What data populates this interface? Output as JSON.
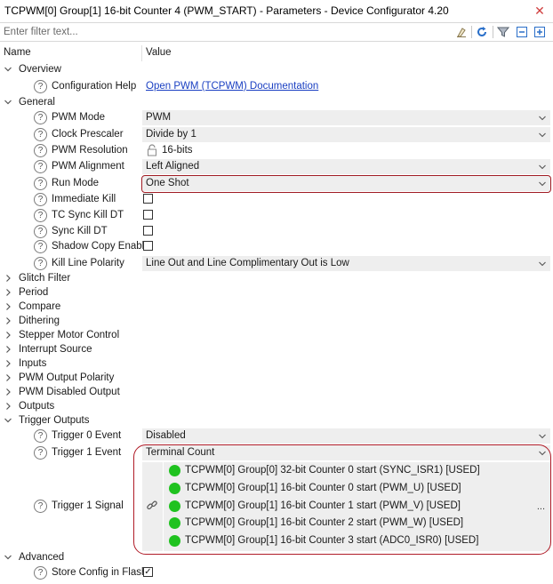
{
  "window": {
    "title": "TCPWM[0] Group[1] 16-bit Counter 4 (PWM_START) - Parameters - Device Configurator 4.20"
  },
  "filter": {
    "placeholder": "Enter filter text..."
  },
  "columns": {
    "name": "Name",
    "value": "Value"
  },
  "groups": {
    "overview": "Overview",
    "general": "General",
    "glitch_filter": "Glitch Filter",
    "period": "Period",
    "compare": "Compare",
    "dithering": "Dithering",
    "stepper_motor_control": "Stepper Motor Control",
    "interrupt_source": "Interrupt Source",
    "inputs": "Inputs",
    "pwm_output_polarity": "PWM Output Polarity",
    "pwm_disabled_output": "PWM Disabled Output",
    "outputs": "Outputs",
    "trigger_outputs": "Trigger Outputs",
    "advanced": "Advanced"
  },
  "overview": {
    "configuration_help": {
      "label": "Configuration Help",
      "value": "Open PWM (TCPWM) Documentation"
    }
  },
  "general": {
    "pwm_mode": {
      "label": "PWM Mode",
      "value": "PWM"
    },
    "clock_prescaler": {
      "label": "Clock Prescaler",
      "value": "Divide by 1"
    },
    "pwm_resolution": {
      "label": "PWM Resolution",
      "value": "16-bits"
    },
    "pwm_alignment": {
      "label": "PWM Alignment",
      "value": "Left Aligned"
    },
    "run_mode": {
      "label": "Run Mode",
      "value": "One Shot"
    },
    "immediate_kill": {
      "label": "Immediate Kill",
      "checked": false
    },
    "tc_sync_kill_dt": {
      "label": "TC Sync Kill DT",
      "checked": false
    },
    "sync_kill_dt": {
      "label": "Sync Kill DT",
      "checked": false
    },
    "shadow_copy_enable": {
      "label": "Shadow Copy Enable",
      "checked": false
    },
    "kill_line_polarity": {
      "label": "Kill Line Polarity",
      "value": "Line Out and Line Complimentary Out is Low"
    }
  },
  "trigger_outputs": {
    "trigger0_event": {
      "label": "Trigger 0 Event",
      "value": "Disabled"
    },
    "trigger1_event": {
      "label": "Trigger 1 Event",
      "value": "Terminal Count"
    },
    "trigger1_signal": {
      "label": "Trigger 1 Signal",
      "more": "...",
      "signals": [
        "TCPWM[0] Group[0] 32-bit Counter 0 start (SYNC_ISR1) [USED]",
        "TCPWM[0] Group[1] 16-bit Counter 0 start (PWM_U) [USED]",
        "TCPWM[0] Group[1] 16-bit Counter 1 start (PWM_V) [USED]",
        "TCPWM[0] Group[1] 16-bit Counter 2 start (PWM_W) [USED]",
        "TCPWM[0] Group[1] 16-bit Counter 3 start (ADC0_ISR0) [USED]"
      ]
    }
  },
  "advanced": {
    "store_config_in_flash": {
      "label": "Store Config in Flash",
      "checked": true
    }
  },
  "colors": {
    "highlight": "#a01c24",
    "signal_dot": "#1fc21f",
    "link": "#1a3fc2",
    "dropdown_bg": "#eeeeee"
  },
  "icons": {
    "help": "?",
    "check": "✓",
    "close": "✕"
  }
}
